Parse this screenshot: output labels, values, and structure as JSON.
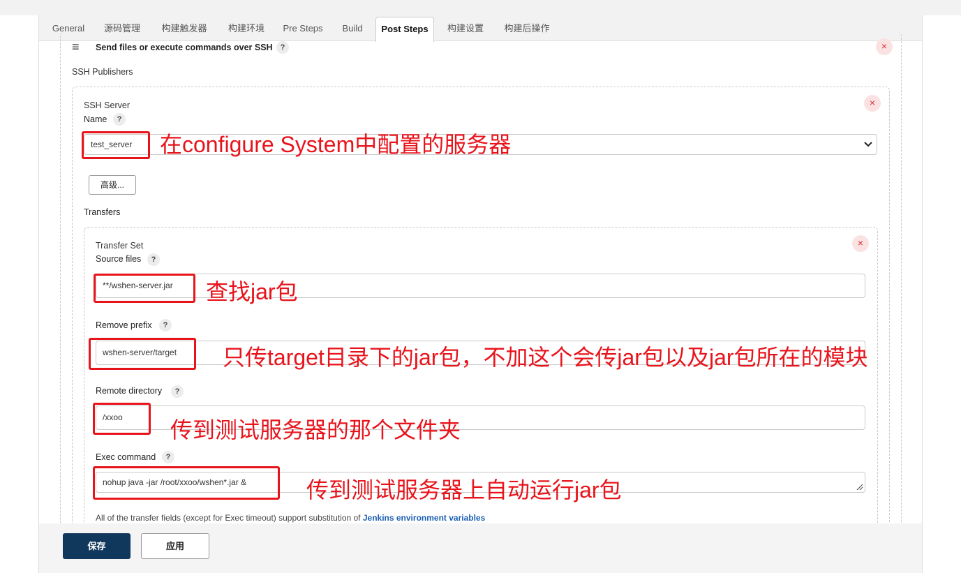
{
  "tabs": [
    {
      "label": "General"
    },
    {
      "label": "源码管理"
    },
    {
      "label": "构建触发器"
    },
    {
      "label": "构建环境"
    },
    {
      "label": "Pre Steps"
    },
    {
      "label": "Build"
    },
    {
      "label": "Post Steps"
    },
    {
      "label": "构建设置"
    },
    {
      "label": "构建后操作"
    }
  ],
  "step": {
    "title": "Send files or execute commands over SSH",
    "publishers_label": "SSH Publishers",
    "server": {
      "section_label": "SSH Server",
      "name_label": "Name",
      "name_value": "test_server",
      "advanced_label": "高级...",
      "transfers_label": "Transfers"
    },
    "transfer": {
      "section_label": "Transfer Set",
      "source_label": "Source files",
      "source_value": "**/wshen-server.jar",
      "prefix_label": "Remove prefix",
      "prefix_value": "wshen-server/target",
      "remote_label": "Remote directory",
      "remote_value": "/xxoo",
      "exec_label": "Exec command",
      "exec_value": "nohup java -jar /root/xxoo/wshen*.jar &",
      "note_prefix": "All of the transfer fields (except for Exec timeout) support substitution of",
      "note_link": "Jenkins environment variables"
    }
  },
  "annotations": {
    "name": "在configure System中配置的服务器",
    "source": "查找jar包",
    "prefix": "只传target目录下的jar包，不加这个会传jar包以及jar包所在的模块",
    "remote": "传到测试服务器的那个文件夹",
    "exec": "传到测试服务器上自动运行jar包"
  },
  "buttons": {
    "save": "保存",
    "apply": "应用"
  },
  "icons": {
    "help": "?",
    "close": "×",
    "drag": "≡"
  },
  "colors": {
    "annotation": "#e8141c",
    "save_bg": "#10375c",
    "link": "#1a5fb4"
  }
}
